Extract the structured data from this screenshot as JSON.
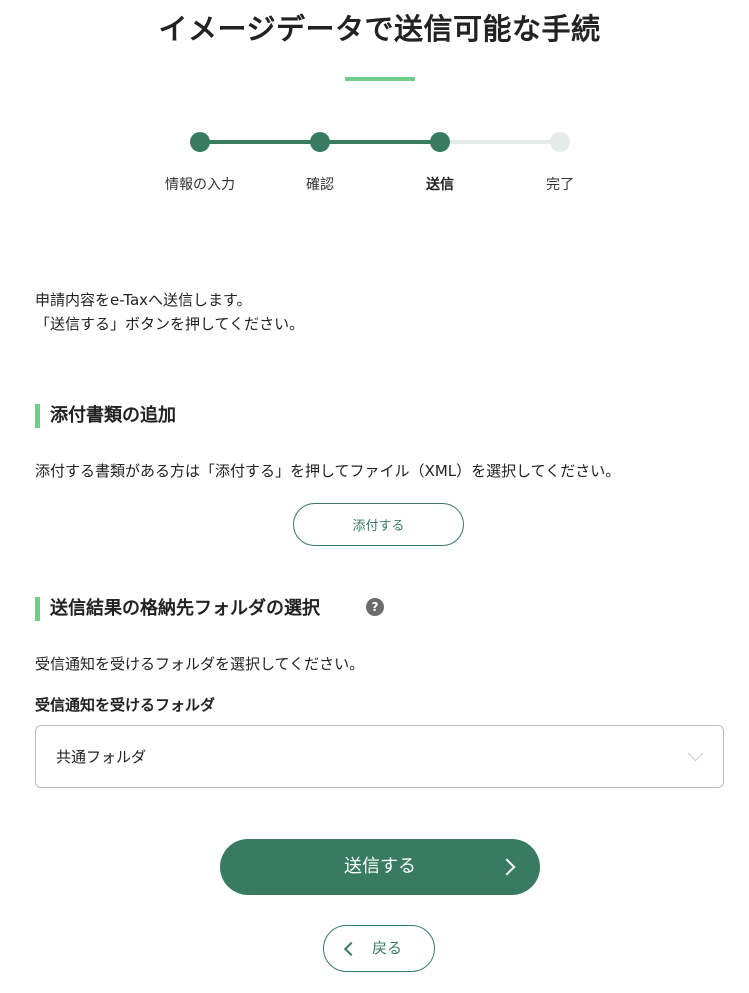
{
  "page": {
    "title": "イメージデータで送信可能な手続"
  },
  "stepper": {
    "steps": [
      {
        "label": "情報の入力",
        "state": "done"
      },
      {
        "label": "確認",
        "state": "done"
      },
      {
        "label": "送信",
        "state": "current"
      },
      {
        "label": "完了",
        "state": "todo"
      }
    ]
  },
  "intro": {
    "line1": "申請内容をe-Taxへ送信します。",
    "line2": "「送信する」ボタンを押してください。"
  },
  "attachment_section": {
    "heading": "添付書類の追加",
    "description": "添付する書類がある方は「添付する」を押してファイル（XML）を選択してください。",
    "button_label": "添付する"
  },
  "folder_section": {
    "heading": "送信結果の格納先フォルダの選択",
    "help_icon": "?",
    "description": "受信通知を受けるフォルダを選択してください。",
    "field_label": "受信通知を受けるフォルダ",
    "selected_value": "共通フォルダ"
  },
  "actions": {
    "submit_label": "送信する",
    "back_label": "戻る"
  },
  "colors": {
    "primary": "#387b61",
    "accent": "#6fcf8a",
    "inactive": "#e4eae8"
  }
}
